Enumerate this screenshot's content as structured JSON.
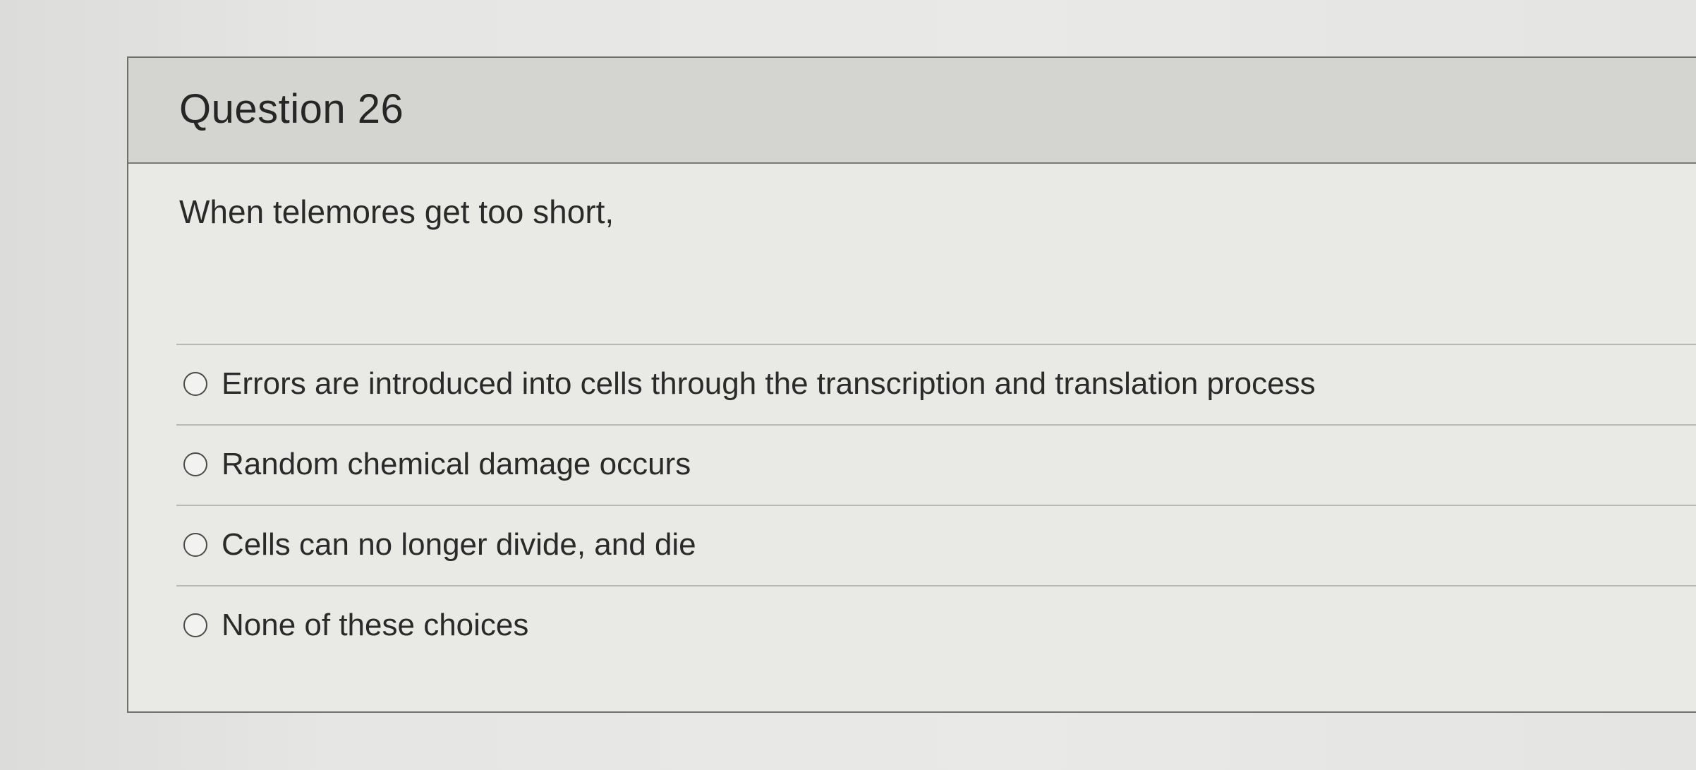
{
  "question": {
    "title": "Question 26",
    "prompt": "When telemores get too short,",
    "choices": [
      {
        "label": "Errors are introduced into cells through the transcription and translation process",
        "selected": false
      },
      {
        "label": "Random chemical damage occurs",
        "selected": false
      },
      {
        "label": "Cells can no longer divide, and die",
        "selected": false
      },
      {
        "label": "None of these choices",
        "selected": false
      }
    ]
  }
}
